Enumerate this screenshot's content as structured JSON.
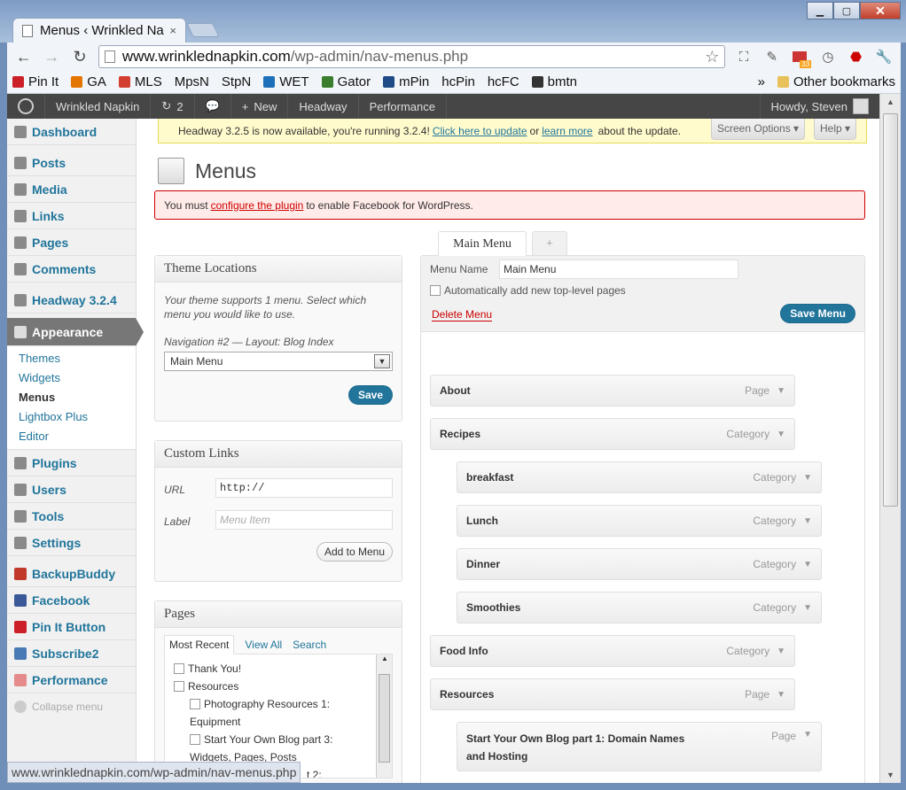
{
  "browser": {
    "tab_title": "Menus ‹ Wrinkled Na",
    "tab_close": "×",
    "window_buttons": {
      "minimize": "▁",
      "maximize": "▢",
      "close": "✕"
    },
    "url_host": "www.wrinklednapkin.com",
    "url_path": "/wp-admin/nav-menus.php",
    "bookmarks": [
      {
        "label": "Pin It",
        "color": "#cb2027"
      },
      {
        "label": "GA",
        "color": "#e37400"
      },
      {
        "label": "MLS",
        "color": "#d23f31"
      },
      {
        "label": "MpsN",
        "color": ""
      },
      {
        "label": "StpN",
        "color": ""
      },
      {
        "label": "WET",
        "color": "#1e6fb9"
      },
      {
        "label": "Gator",
        "color": "#3a7d2c"
      },
      {
        "label": "mPin",
        "color": "#1e4a86"
      },
      {
        "label": "hcPin",
        "color": ""
      },
      {
        "label": "hcFC",
        "color": ""
      },
      {
        "label": "bmtn",
        "color": "#333"
      }
    ],
    "other_bookmarks": "Other bookmarks",
    "badge": "33",
    "status_url": "www.wrinklednapkin.com/wp-admin/nav-menus.php"
  },
  "adminbar": {
    "site": "Wrinkled Napkin",
    "updates": "2",
    "new": "New",
    "headway": "Headway",
    "performance": "Performance",
    "howdy": "Howdy, Steven"
  },
  "sidebar": {
    "group1": [
      {
        "label": "Dashboard",
        "icon": "dashboard-icon"
      }
    ],
    "group2": [
      {
        "label": "Posts",
        "icon": "posts-icon"
      },
      {
        "label": "Media",
        "icon": "media-icon"
      },
      {
        "label": "Links",
        "icon": "links-icon"
      },
      {
        "label": "Pages",
        "icon": "pages-icon"
      },
      {
        "label": "Comments",
        "icon": "comments-icon"
      }
    ],
    "headway": "Headway 3.2.4",
    "appearance": "Appearance",
    "appearance_sub": [
      "Themes",
      "Widgets",
      "Menus",
      "Lightbox Plus",
      "Editor"
    ],
    "group3": [
      {
        "label": "Plugins",
        "icon": "plugins-icon"
      },
      {
        "label": "Users",
        "icon": "users-icon"
      },
      {
        "label": "Tools",
        "icon": "tools-icon"
      },
      {
        "label": "Settings",
        "icon": "settings-icon"
      }
    ],
    "group4": [
      {
        "label": "BackupBuddy",
        "icon": "backupbuddy-icon",
        "color": "#c0392b"
      },
      {
        "label": "Facebook",
        "icon": "facebook-icon",
        "color": "#3b5998"
      },
      {
        "label": "Pin It Button",
        "icon": "pinit-icon",
        "color": "#cb2027"
      },
      {
        "label": "Subscribe2",
        "icon": "subscribe2-icon",
        "color": "#4a7ab5"
      },
      {
        "label": "Performance",
        "icon": "performance-icon",
        "color": "#e58b8b"
      }
    ],
    "collapse": "Collapse menu"
  },
  "notice_update": {
    "pre": "Headway 3.2.5 is now available, you're running 3.2.4!",
    "link1": "Click here to update",
    "mid": "or",
    "link2": "learn more",
    "post": "about the update."
  },
  "screen_options": "Screen Options ▾",
  "help": "Help ▾",
  "page_title": "Menus",
  "notice_fb": {
    "pre": "You must",
    "link": "configure the plugin",
    "post": "to enable Facebook for WordPress."
  },
  "theme_locations": {
    "title": "Theme Locations",
    "desc": "Your theme supports 1 menu. Select which menu you would like to use.",
    "nav_label": "Navigation #2 — Layout: Blog Index",
    "selected": "Main Menu",
    "save": "Save"
  },
  "custom_links": {
    "title": "Custom Links",
    "url_label": "URL",
    "url_value": "http://",
    "label_label": "Label",
    "label_placeholder": "Menu Item",
    "add": "Add to Menu"
  },
  "pages_box": {
    "title": "Pages",
    "tabs": [
      "Most Recent",
      "View All",
      "Search"
    ],
    "items": [
      {
        "label": "Thank You!",
        "indent": 0
      },
      {
        "label": "Resources",
        "indent": 0
      },
      {
        "label": "Photography Resources 1:",
        "label2": "Equipment",
        "indent": 1
      },
      {
        "label": "Start Your Own Blog part 3:",
        "label2": "Widgets, Pages, Posts",
        "indent": 1
      }
    ],
    "partial": "t 2:"
  },
  "menu_tabs": {
    "main": "Main Menu",
    "add": "+"
  },
  "menu_edit": {
    "name_label": "Menu Name",
    "name_value": "Main Menu",
    "auto_add": "Automatically add new top-level pages",
    "delete": "Delete Menu",
    "save": "Save Menu"
  },
  "menu_items": [
    {
      "label": "About",
      "type": "Page",
      "depth": 0
    },
    {
      "label": "Recipes",
      "type": "Category",
      "depth": 0
    },
    {
      "label": "breakfast",
      "type": "Category",
      "depth": 1
    },
    {
      "label": "Lunch",
      "type": "Category",
      "depth": 1
    },
    {
      "label": "Dinner",
      "type": "Category",
      "depth": 1
    },
    {
      "label": "Smoothies",
      "type": "Category",
      "depth": 1
    },
    {
      "label": "Food Info",
      "type": "Category",
      "depth": 0
    },
    {
      "label": "Resources",
      "type": "Page",
      "depth": 0
    },
    {
      "label": "Start Your Own Blog part 1: Domain Names and Hosting",
      "type": "Page",
      "depth": 1
    }
  ]
}
